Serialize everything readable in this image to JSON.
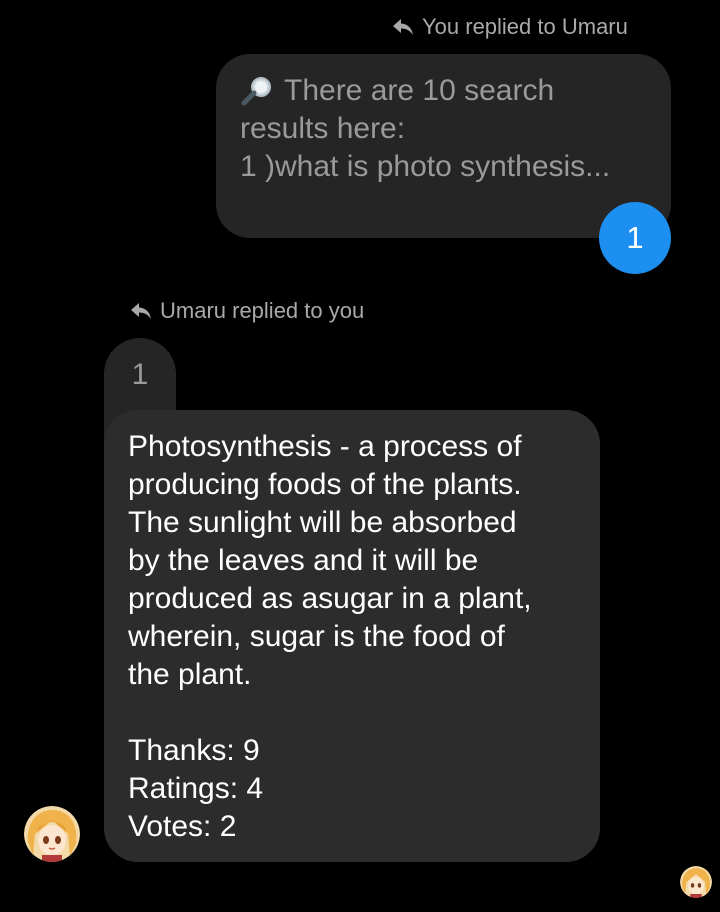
{
  "header_you": {
    "text": "You replied to Umaru",
    "icon": "reply-arrow-icon"
  },
  "quoted_message": {
    "icon": "magnifying-glass-icon",
    "line1": "There are 10 search",
    "line2": "results here:",
    "line3": "1 )what is photo synthesis..."
  },
  "reaction_badge": {
    "count": "1",
    "color": "#1d8ff0"
  },
  "header_umaru": {
    "text": "Umaru replied to you",
    "icon": "reply-arrow-icon"
  },
  "quote_stub": {
    "text": "1"
  },
  "reply_message": {
    "body": [
      "Photosynthesis - a process of",
      "producing foods of the plants.",
      "The sunlight will be absorbed",
      "by the leaves and it will be",
      "produced as asugar in a plant,",
      "wherein, sugar is the food of",
      "the plant."
    ],
    "stats": [
      "Thanks: 9",
      "Ratings: 4",
      "Votes: 2"
    ]
  },
  "avatars": {
    "sender": "anime-girl-avatar",
    "seen": "anime-girl-avatar-small"
  },
  "colors": {
    "background": "#000000",
    "bubble_dark": "#2c2c2c",
    "bubble_quote": "#252525",
    "muted_text": "#a9a9a9"
  }
}
